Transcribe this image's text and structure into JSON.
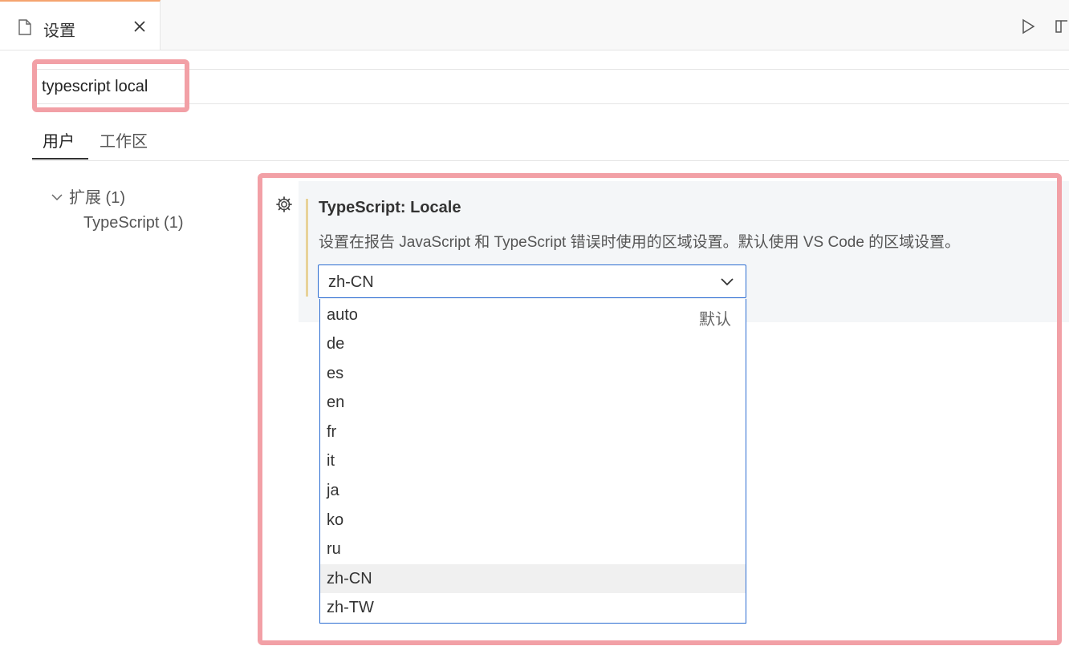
{
  "tab": {
    "label": "设置",
    "close_label": "✕"
  },
  "search": {
    "value": "typescript local"
  },
  "scopes": [
    {
      "label": "用户"
    },
    {
      "label": "工作区"
    }
  ],
  "tree": {
    "group": "扩展 (1)",
    "leaf": "TypeScript (1)"
  },
  "setting": {
    "title": "TypeScript: Locale",
    "description": "设置在报告 JavaScript 和 TypeScript 错误时使用的区域设置。默认使用 VS Code 的区域设置。",
    "current": "zh-CN"
  },
  "dropdown": {
    "options": [
      {
        "label": "auto",
        "badge": "默认"
      },
      {
        "label": "de"
      },
      {
        "label": "es"
      },
      {
        "label": "en"
      },
      {
        "label": "fr"
      },
      {
        "label": "it"
      },
      {
        "label": "ja"
      },
      {
        "label": "ko"
      },
      {
        "label": "ru"
      },
      {
        "label": "zh-CN",
        "selected": true
      },
      {
        "label": "zh-TW"
      }
    ]
  },
  "colors": {
    "highlight": "#f2a0a6",
    "focus": "#2b6cd1",
    "tab_accent": "#f5a46f",
    "modified": "#e8d39a"
  }
}
